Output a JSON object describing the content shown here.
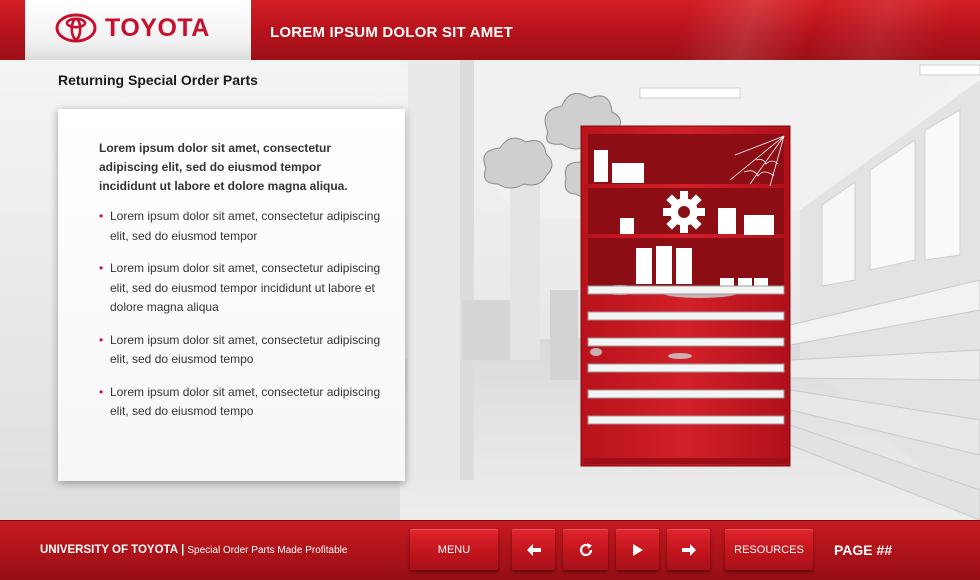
{
  "header": {
    "brand": "TOYOTA",
    "title": "LOREM IPSUM DOLOR SIT AMET"
  },
  "content": {
    "subtitle": "Returning Special Order Parts",
    "lead": "Lorem ipsum dolor sit amet, consectetur adipiscing elit, sed do eiusmod tempor incididunt ut labore et dolore magna aliqua.",
    "bullets": [
      "Lorem ipsum dolor sit amet, consectetur adipiscing elit, sed do eiusmod tempor",
      "Lorem ipsum dolor sit amet, consectetur adipiscing elit, sed do eiusmod tempor incididunt ut labore et dolore magna aliqua",
      "Lorem ipsum dolor sit amet, consectetur adipiscing elit, sed do eiusmod tempo",
      "Lorem ipsum dolor sit amet, consectetur adipiscing elit, sed do eiusmod tempo"
    ]
  },
  "footer": {
    "university": "UNIVERSITY OF TOYOTA",
    "separator": "|",
    "course": "Special Order Parts Made Profitable",
    "menu_label": "MENU",
    "resources_label": "RESOURCES",
    "page_label": "PAGE ##",
    "icons": {
      "back": "arrow-left-icon",
      "replay": "refresh-icon",
      "play": "play-icon",
      "next": "arrow-right-icon"
    }
  },
  "colors": {
    "brand_red": "#c8102e",
    "bar_red": "#b5121b"
  }
}
